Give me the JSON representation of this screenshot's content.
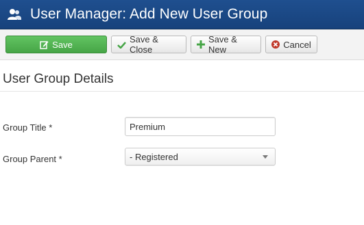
{
  "header": {
    "title": "User Manager: Add New User Group",
    "icon": "users-icon"
  },
  "toolbar": {
    "save_label": "Save",
    "save_close_label": "Save & Close",
    "save_new_label": "Save & New",
    "cancel_label": "Cancel"
  },
  "section": {
    "title": "User Group Details"
  },
  "form": {
    "group_title_label": "Group Title *",
    "group_title_value": "Premium",
    "group_parent_label": "Group Parent *",
    "group_parent_value": "- Registered"
  },
  "colors": {
    "header_bg": "#1a4783",
    "save_green": "#46a546",
    "cancel_red": "#c0392b"
  }
}
